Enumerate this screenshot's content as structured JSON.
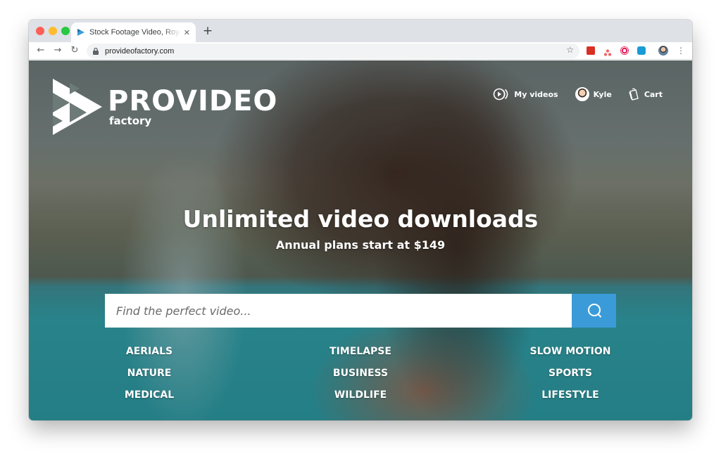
{
  "browser": {
    "tab_title": "Stock Footage Video, Royalty-Free",
    "new_tab_symbol": "+",
    "close_symbol": "✕",
    "url": "provideofactory.com",
    "nav": {
      "back": "←",
      "forward": "→",
      "reload": "↻"
    },
    "star_symbol": "☆",
    "menu_symbol": "⋮",
    "icons": [
      "back-arrow-icon",
      "forward-arrow-icon",
      "reload-icon",
      "lock-icon",
      "bookmark-star-icon",
      "extension-icon",
      "profile-avatar-icon",
      "kebab-menu-icon"
    ]
  },
  "site": {
    "logo_word": "PROVIDEO",
    "logo_sub": "factory",
    "nav": {
      "my_videos": "My videos",
      "user": "Kyle",
      "cart": "Cart"
    },
    "headline": "Unlimited video downloads",
    "subhead": "Annual plans start at $149",
    "search": {
      "placeholder": "Find the perfect video..."
    },
    "categories": [
      [
        "AERIALS",
        "TIMELAPSE",
        "SLOW MOTION"
      ],
      [
        "NATURE",
        "BUSINESS",
        "SPORTS"
      ],
      [
        "MEDICAL",
        "WILDLIFE",
        "LIFESTYLE"
      ]
    ],
    "colors": {
      "search_button": "#3b9bd9",
      "text": "#ffffff"
    }
  }
}
